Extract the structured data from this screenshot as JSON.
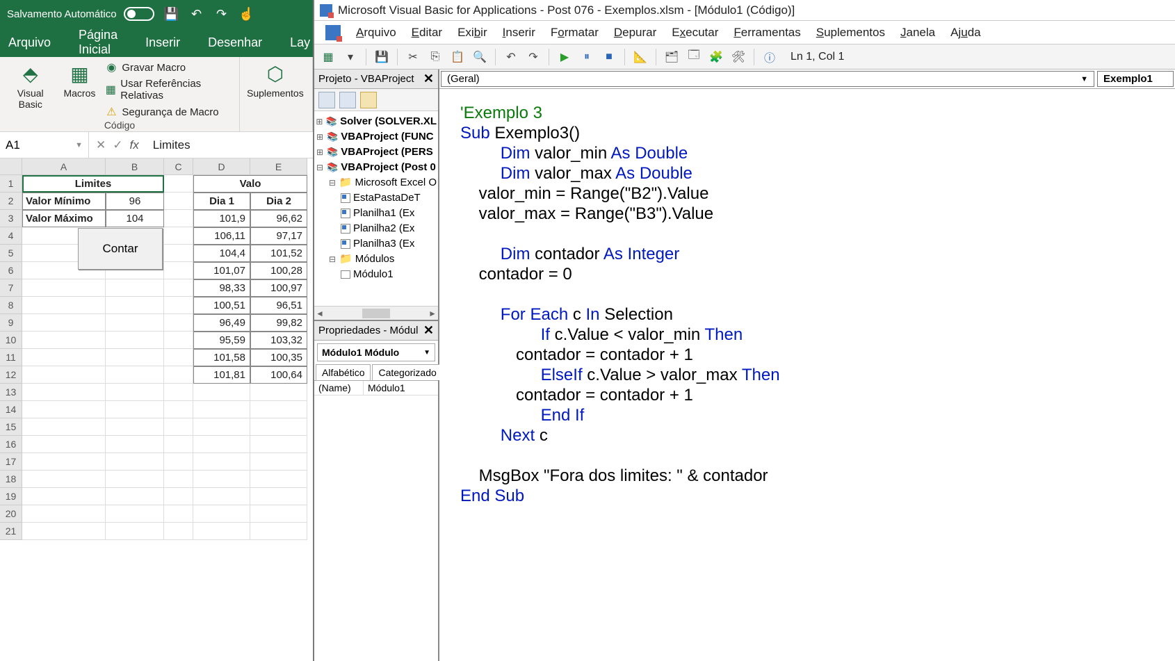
{
  "excel": {
    "title_autosave": "Salvamento Automático",
    "tabs": [
      "Arquivo",
      "Página Inicial",
      "Inserir",
      "Desenhar",
      "Lay"
    ],
    "ribbon": {
      "visual_basic": "Visual\nBasic",
      "macros": "Macros",
      "gravar_macro": "Gravar Macro",
      "usar_refs": "Usar Referências Relativas",
      "seg_macro": "Segurança de Macro",
      "codigo": "Código",
      "suplementos": "Suplementos"
    },
    "name_box": "A1",
    "formula_value": "Limites",
    "cols": [
      "A",
      "B",
      "C",
      "D",
      "E"
    ],
    "rows": [
      "1",
      "2",
      "3",
      "4",
      "5",
      "6",
      "7",
      "8",
      "9",
      "10",
      "11",
      "12",
      "13",
      "14",
      "15",
      "16",
      "17",
      "18",
      "19",
      "20",
      "21"
    ],
    "cells": {
      "A1": "Limites",
      "A2": "Valor Mínimo",
      "B2": "96",
      "A3": "Valor Máximo",
      "B3": "104",
      "D1": "Dia 1",
      "E1": "Dia 2",
      "E0": "Valo",
      "D2": "101,9",
      "E2": "96,62",
      "D3": "106,11",
      "E3": "97,17",
      "D4": "104,4",
      "E4": "101,52",
      "D5": "101,07",
      "E5": "100,28",
      "D6": "98,33",
      "E6": "100,97",
      "D7": "100,51",
      "E7": "96,51",
      "D8": "96,49",
      "E8": "99,82",
      "D9": "95,59",
      "E9": "103,32",
      "D10": "101,58",
      "E10": "100,35",
      "D11": "101,81",
      "E11": "100,64"
    },
    "button_contar": "Contar"
  },
  "vba": {
    "title": "Microsoft Visual Basic for Applications - Post 076 - Exemplos.xlsm - [Módulo1 (Código)]",
    "menus": {
      "arquivo": "Arquivo",
      "editar": "Editar",
      "exibir": "Exibir",
      "inserir": "Inserir",
      "formatar": "Formatar",
      "depurar": "Depurar",
      "executar": "Executar",
      "ferramentas": "Ferramentas",
      "suplementos": "Suplementos",
      "janela": "Janela",
      "ajuda": "Ajuda"
    },
    "status": "Ln 1, Col 1",
    "project_panel": "Projeto - VBAProject",
    "tree": {
      "p1": "Solver (SOLVER.XL",
      "p2": "VBAProject (FUNC",
      "p3": "VBAProject (PERS",
      "p4": "VBAProject (Post 0",
      "f1": "Microsoft Excel O",
      "s1": "EstaPastaDeT",
      "s2": "Planilha1 (Ex",
      "s3": "Planilha2 (Ex",
      "s4": "Planilha3 (Ex",
      "f2": "Módulos",
      "m1": "Módulo1"
    },
    "props_panel": "Propriedades - Módul",
    "props_select": "Módulo1 Módulo",
    "props_tabs": {
      "a": "Alfabético",
      "c": "Categorizado"
    },
    "props_name_k": "(Name)",
    "props_name_v": "Módulo1",
    "dd_left": "(Geral)",
    "dd_right": "Exemplo1",
    "code": {
      "l1": "'Exemplo 3",
      "l2a": "Sub",
      "l2b": " Exemplo3()",
      "l3a": "Dim",
      "l3b": " valor_min ",
      "l3c": "As Double",
      "l4a": "Dim",
      "l4b": " valor_max ",
      "l4c": "As Double",
      "l5": "    valor_min = Range(\"B2\").Value",
      "l6": "    valor_max = Range(\"B3\").Value",
      "l8a": "Dim",
      "l8b": " contador ",
      "l8c": "As Integer",
      "l9": "    contador = 0",
      "l11a": "For Each",
      "l11b": " c ",
      "l11c": "In",
      "l11d": " Selection",
      "l12a": "If",
      "l12b": " c.Value < valor_min ",
      "l12c": "Then",
      "l13": "            contador = contador + 1",
      "l14a": "ElseIf",
      "l14b": " c.Value > valor_max ",
      "l14c": "Then",
      "l15": "            contador = contador + 1",
      "l16": "End If",
      "l17a": "Next",
      "l17b": " c",
      "l19": "    MsgBox \"Fora dos limites: \" & contador",
      "l20": "End Sub"
    }
  }
}
